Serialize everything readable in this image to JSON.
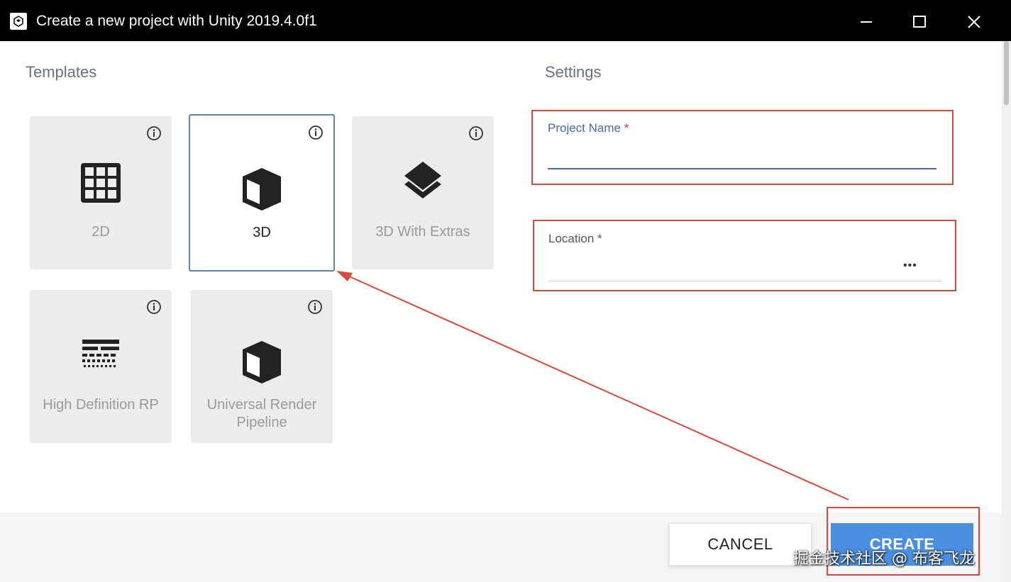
{
  "window": {
    "title": "Create a new project with Unity 2019.4.0f1"
  },
  "templates": {
    "heading": "Templates",
    "items": [
      {
        "label": "2D",
        "icon": "grid-icon",
        "selected": false
      },
      {
        "label": "3D",
        "icon": "cube-icon",
        "selected": true
      },
      {
        "label": "3D With Extras",
        "icon": "layers-icon",
        "selected": false
      },
      {
        "label": "High Definition RP",
        "icon": "hdrp-icon",
        "selected": false
      },
      {
        "label": "Universal Render Pipeline",
        "icon": "cube-icon",
        "selected": false
      }
    ]
  },
  "settings": {
    "heading": "Settings",
    "project_name": {
      "label": "Project Name",
      "required_mark": "*",
      "value": ""
    },
    "location": {
      "label": "Location",
      "required_mark": "*",
      "value": "",
      "browse_label": "•••"
    }
  },
  "buttons": {
    "cancel": "CANCEL",
    "create": "CREATE"
  },
  "watermark": "掘金技术社区 @ 布客飞龙",
  "colors": {
    "accent": "#4a8ee0",
    "selection_border": "#5b86b6",
    "annotation_red": "#d64b3c",
    "field_underline": "#4a6aa8"
  }
}
